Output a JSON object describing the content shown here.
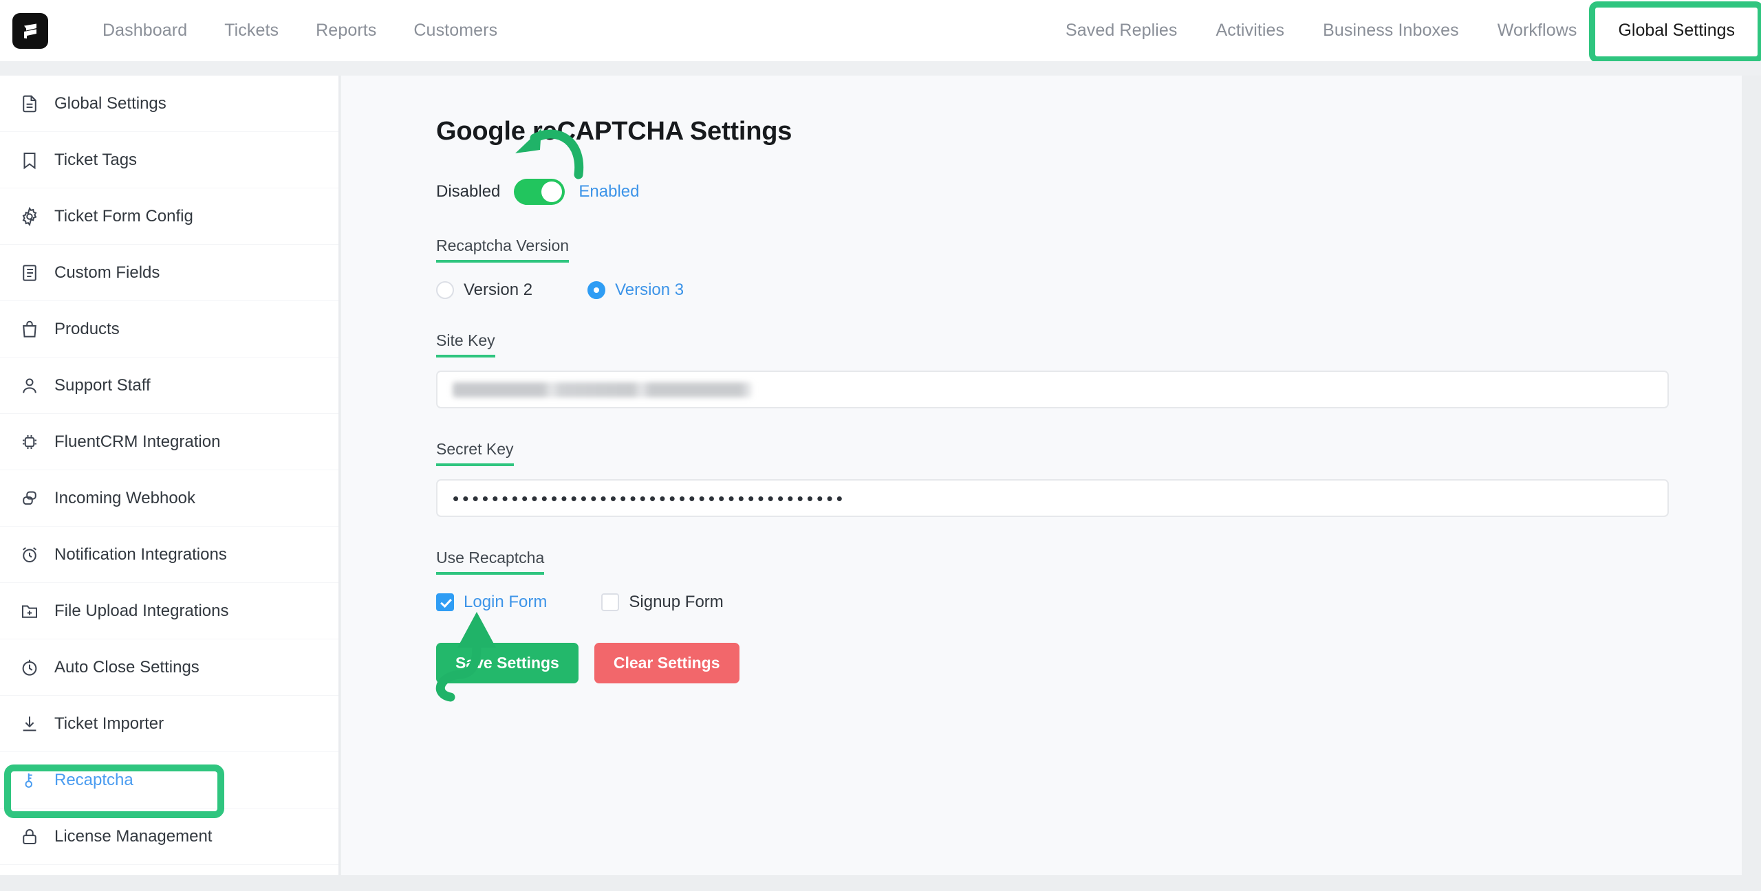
{
  "app": {
    "logo_icon": "fluent-support-logo-icon"
  },
  "topnav": {
    "left_items": [
      {
        "label": "Dashboard"
      },
      {
        "label": "Tickets"
      },
      {
        "label": "Reports"
      },
      {
        "label": "Customers"
      }
    ],
    "right_items": [
      {
        "label": "Saved Replies"
      },
      {
        "label": "Activities"
      },
      {
        "label": "Business Inboxes"
      },
      {
        "label": "Workflows"
      }
    ],
    "active_item": {
      "label": "Global Settings"
    }
  },
  "sidebar": {
    "items": [
      {
        "label": "Global Settings",
        "icon": "document-icon"
      },
      {
        "label": "Ticket Tags",
        "icon": "bookmark-icon"
      },
      {
        "label": "Ticket Form Config",
        "icon": "gear-icon"
      },
      {
        "label": "Custom Fields",
        "icon": "list-document-icon"
      },
      {
        "label": "Products",
        "icon": "bag-icon"
      },
      {
        "label": "Support Staff",
        "icon": "user-icon"
      },
      {
        "label": "FluentCRM Integration",
        "icon": "chip-icon"
      },
      {
        "label": "Incoming Webhook",
        "icon": "webhook-icon"
      },
      {
        "label": "Notification Integrations",
        "icon": "alarm-clock-icon"
      },
      {
        "label": "File Upload Integrations",
        "icon": "folder-plus-icon"
      },
      {
        "label": "Auto Close Settings",
        "icon": "stopwatch-icon"
      },
      {
        "label": "Ticket Importer",
        "icon": "download-icon"
      },
      {
        "label": "Recaptcha",
        "icon": "key-icon"
      },
      {
        "label": "License Management",
        "icon": "lock-icon"
      }
    ],
    "active_index": 12
  },
  "main": {
    "title": "Google reCAPTCHA Settings",
    "toggle": {
      "off_label": "Disabled",
      "on_label": "Enabled",
      "state": "Enabled"
    },
    "version": {
      "label": "Recaptcha Version",
      "options": [
        {
          "label": "Version 2",
          "selected": false
        },
        {
          "label": "Version 3",
          "selected": true
        }
      ]
    },
    "site_key": {
      "label": "Site Key",
      "value": "",
      "redacted": true
    },
    "secret_key": {
      "label": "Secret Key",
      "value": "••••••••••••••••••••••••••••••••••••••••"
    },
    "use_recaptcha": {
      "label": "Use Recaptcha",
      "options": [
        {
          "label": "Login Form",
          "checked": true
        },
        {
          "label": "Signup Form",
          "checked": false
        }
      ]
    },
    "buttons": {
      "save_label": "Save Settings",
      "clear_label": "Clear Settings"
    }
  },
  "annotations": {
    "highlight_color": "#2fc57f",
    "arrow_to_toggle": "curved-arrow-icon",
    "arrow_to_save": "curved-arrow-up-icon",
    "box_global_settings": "highlight-box",
    "box_recaptcha": "highlight-box"
  },
  "colors": {
    "accent_green": "#23b86b",
    "danger_red": "#f2676b",
    "link_blue": "#3d94e8",
    "toggle_on": "#22c55e",
    "annotation_green": "#2fc57f"
  }
}
